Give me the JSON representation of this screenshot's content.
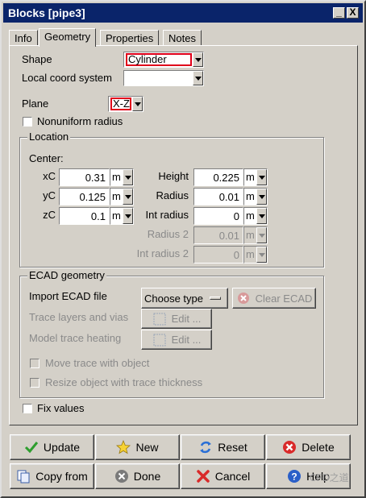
{
  "window": {
    "title": "Blocks [pipe3]"
  },
  "title_buttons": {
    "minimize": "_",
    "close": "X"
  },
  "tabs": [
    {
      "label": "Info"
    },
    {
      "label": "Geometry"
    },
    {
      "label": "Properties"
    },
    {
      "label": "Notes"
    }
  ],
  "active_tab": "Geometry",
  "shape": {
    "label": "Shape",
    "value": "Cylinder"
  },
  "local_coord": {
    "label": "Local coord system",
    "value": ""
  },
  "plane": {
    "label": "Plane",
    "value": "X-Z"
  },
  "nonuniform_radius": {
    "label": "Nonuniform radius",
    "checked": false
  },
  "location": {
    "title": "Location",
    "center_label": "Center:",
    "xC": {
      "label": "xC",
      "value": "0.31",
      "unit": "m"
    },
    "yC": {
      "label": "yC",
      "value": "0.125",
      "unit": "m"
    },
    "zC": {
      "label": "zC",
      "value": "0.1",
      "unit": "m"
    },
    "height": {
      "label": "Height",
      "value": "0.225",
      "unit": "m"
    },
    "radius": {
      "label": "Radius",
      "value": "0.01",
      "unit": "m"
    },
    "int_radius": {
      "label": "Int radius",
      "value": "0",
      "unit": "m"
    },
    "radius2": {
      "label": "Radius 2",
      "value": "0.01",
      "unit": "m"
    },
    "int_radius2": {
      "label": "Int radius 2",
      "value": "0",
      "unit": "m"
    }
  },
  "ecad": {
    "title": "ECAD geometry",
    "import_label": "Import ECAD file",
    "choose_type": "Choose type",
    "clear_ecad": "Clear ECAD",
    "trace_layers_label": "Trace layers and vias",
    "model_trace_label": "Model trace heating",
    "edit_label": "Edit ...",
    "move_trace": "Move trace with object",
    "resize_object": "Resize object with trace thickness"
  },
  "fix_values": {
    "label": "Fix values",
    "checked": false
  },
  "buttons": {
    "update": "Update",
    "new": "New",
    "reset": "Reset",
    "delete": "Delete",
    "copy_from": "Copy from",
    "done": "Done",
    "cancel": "Cancel",
    "help": "Help"
  },
  "watermark": "CFD之道",
  "colors": {
    "titlebar": "#0a246a",
    "highlight_border": "#e0001a",
    "dialog_bg": "#d4d0c8"
  }
}
